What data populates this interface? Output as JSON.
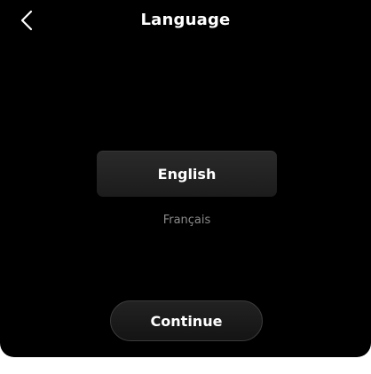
{
  "header": {
    "title": "Language",
    "back_icon": "chevron-left-icon"
  },
  "languages": [
    {
      "label": "English",
      "selected": true
    },
    {
      "label": "Français",
      "selected": false
    }
  ],
  "footer": {
    "continue_label": "Continue"
  },
  "colors": {
    "background": "#000000",
    "selected_option_bg": "#242424",
    "unselected_text": "#8a8a8a",
    "text": "#ffffff"
  }
}
